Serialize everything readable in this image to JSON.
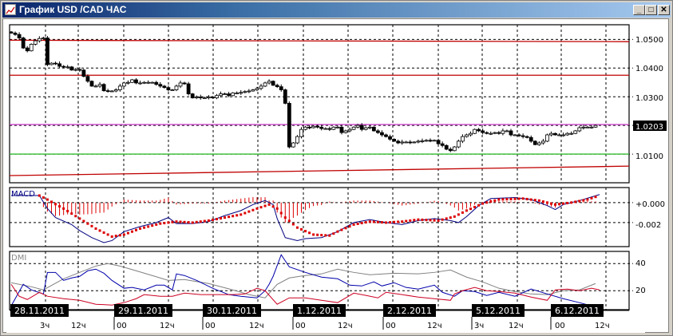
{
  "window": {
    "title": "График USD /CAD  ЧАС",
    "minimize_label": "_",
    "maximize_label": "□",
    "close_label": "✕"
  },
  "colors": {
    "bull": "#ffffff",
    "bear": "#000000",
    "resistance": "#c00000",
    "pivot": "#cc44cc",
    "support": "#33bb33",
    "macd": "#000080",
    "signal": "#dd0000",
    "plus_di": "#0000aa",
    "minus_di": "#cc0022",
    "adx": "#808080"
  },
  "price_axis": {
    "ticks": [
      "1.0500",
      "1.0400",
      "1.0300",
      "1.0100"
    ],
    "current_price": "1.0203"
  },
  "macd_panel": {
    "label": "MACD",
    "ticks": [
      "+0.000",
      "-0.002"
    ]
  },
  "dmi_panel": {
    "label": "DMI",
    "ticks": [
      "40",
      "20"
    ]
  },
  "time_axis": {
    "dates": [
      "28.11.2011",
      "29.11.2011",
      "30.11.2011",
      "1.12.2011",
      "2.12.2011",
      "5.12.2011",
      "6.12.2011"
    ],
    "hours": [
      "3ч",
      "12ч",
      "00",
      "12ч",
      "00",
      "12ч",
      "00",
      "12ч",
      "00",
      "12ч",
      "3ч",
      "12ч",
      "00",
      "12ч"
    ]
  },
  "chart_data": [
    {
      "type": "candlestick",
      "title": "USD/CAD H1",
      "ylim": [
        1.0,
        1.0551
      ],
      "yticks": [
        1.05,
        1.04,
        1.03,
        1.02,
        1.01
      ],
      "levels": [
        {
          "name": "resistance-upper",
          "from": 1.0497,
          "to": 1.0492
        },
        {
          "name": "resistance-mid",
          "from": 1.0375,
          "to": 1.0375
        },
        {
          "name": "pivot",
          "from": 1.0203,
          "to": 1.0203
        },
        {
          "name": "support",
          "from": 1.01,
          "to": 1.01
        },
        {
          "name": "trend-lower",
          "from": 1.0025,
          "to": 1.0058
        }
      ],
      "close": [
        1.0522,
        1.0517,
        1.0505,
        1.047,
        1.046,
        1.0483,
        1.0495,
        1.0503,
        1.0505,
        1.0412,
        1.0417,
        1.0415,
        1.0406,
        1.0404,
        1.0404,
        1.0393,
        1.0395,
        1.0393,
        1.0371,
        1.0354,
        1.0337,
        1.0337,
        1.0343,
        1.0321,
        1.032,
        1.032,
        1.0324,
        1.0337,
        1.0348,
        1.035,
        1.0359,
        1.0348,
        1.0348,
        1.035,
        1.035,
        1.035,
        1.0343,
        1.0337,
        1.0332,
        1.0324,
        1.0324,
        1.0337,
        1.0348,
        1.0345,
        1.031,
        1.0296,
        1.0299,
        1.0296,
        1.0296,
        1.0299,
        1.0296,
        1.0304,
        1.031,
        1.031,
        1.0304,
        1.0313,
        1.0313,
        1.0315,
        1.0318,
        1.032,
        1.0324,
        1.0329,
        1.0337,
        1.0348,
        1.0354,
        1.034,
        1.0335,
        1.0324,
        1.0277,
        1.0125,
        1.0139,
        1.0161,
        1.0186,
        1.0194,
        1.0192,
        1.0197,
        1.0194,
        1.0189,
        1.0189,
        1.0186,
        1.0194,
        1.0194,
        1.0175,
        1.0181,
        1.0186,
        1.0194,
        1.02,
        1.0186,
        1.0192,
        1.0194,
        1.0181,
        1.0175,
        1.0167,
        1.0161,
        1.0152,
        1.0145,
        1.0139,
        1.0142,
        1.0142,
        1.014,
        1.0142,
        1.0145,
        1.0146,
        1.0148,
        1.0147,
        1.0148,
        1.0136,
        1.013,
        1.0117,
        1.0112,
        1.0125,
        1.0145,
        1.0161,
        1.0167,
        1.0172,
        1.0186,
        1.0181,
        1.0175,
        1.0172,
        1.0172,
        1.0175,
        1.0172,
        1.0181,
        1.0181,
        1.0167,
        1.0167,
        1.0164,
        1.0161,
        1.0158,
        1.0145,
        1.0133,
        1.0139,
        1.0145,
        1.0167,
        1.0172,
        1.0167,
        1.0167,
        1.0167,
        1.0172,
        1.0172,
        1.0181,
        1.0192,
        1.0194,
        1.0194,
        1.0194,
        1.02
      ]
    },
    {
      "type": "line",
      "title": "MACD",
      "ylim": [
        -0.0044,
        0.0015
      ],
      "macd": [
        [
          0,
          0.0007
        ],
        [
          7,
          0.0007
        ],
        [
          9,
          -0.0006
        ],
        [
          11,
          -0.0015
        ],
        [
          15,
          -0.0022
        ],
        [
          17,
          -0.0028
        ],
        [
          20,
          -0.0035
        ],
        [
          23,
          -0.004
        ],
        [
          25,
          -0.0038
        ],
        [
          28,
          -0.0029
        ],
        [
          32,
          -0.0024
        ],
        [
          36,
          -0.002
        ],
        [
          39,
          -0.0015
        ],
        [
          41,
          -0.0021
        ],
        [
          45,
          -0.0021
        ],
        [
          49,
          -0.0019
        ],
        [
          53,
          -0.0013
        ],
        [
          57,
          -0.0008
        ],
        [
          60,
          -0.0002
        ],
        [
          63,
          0.0002
        ],
        [
          65,
          -0.0002
        ],
        [
          66,
          -0.0016
        ],
        [
          68,
          -0.0035
        ],
        [
          71,
          -0.0038
        ],
        [
          73,
          -0.0036
        ],
        [
          77,
          -0.0035
        ],
        [
          81,
          -0.0029
        ],
        [
          85,
          -0.002
        ],
        [
          89,
          -0.0017
        ],
        [
          93,
          -0.002
        ],
        [
          97,
          -0.0022
        ],
        [
          101,
          -0.0018
        ],
        [
          105,
          -0.0016
        ],
        [
          109,
          -0.0018
        ],
        [
          111,
          -0.002
        ],
        [
          113,
          -0.0014
        ],
        [
          116,
          -0.0003
        ],
        [
          119,
          0.0004
        ],
        [
          125,
          0.0005
        ],
        [
          129,
          0.0003
        ],
        [
          133,
          -0.0003
        ],
        [
          135,
          -0.0007
        ],
        [
          137,
          -0.0002
        ],
        [
          141,
          0.0002
        ],
        [
          146,
          0.0008
        ]
      ],
      "signal": [
        [
          7,
          0.0007
        ],
        [
          9,
          0.0003
        ],
        [
          13,
          -0.0006
        ],
        [
          17,
          -0.0016
        ],
        [
          21,
          -0.0026
        ],
        [
          25,
          -0.0034
        ],
        [
          28,
          -0.0032
        ],
        [
          32,
          -0.0026
        ],
        [
          37,
          -0.0021
        ],
        [
          41,
          -0.0019
        ],
        [
          45,
          -0.002
        ],
        [
          49,
          -0.0018
        ],
        [
          53,
          -0.0015
        ],
        [
          57,
          -0.0012
        ],
        [
          61,
          -0.0006
        ],
        [
          64,
          -0.0002
        ],
        [
          66,
          -0.0006
        ],
        [
          68,
          -0.0015
        ],
        [
          71,
          -0.0025
        ],
        [
          75,
          -0.0032
        ],
        [
          79,
          -0.0033
        ],
        [
          81,
          -0.0029
        ],
        [
          85,
          -0.0022
        ],
        [
          89,
          -0.0019
        ],
        [
          93,
          -0.002
        ],
        [
          97,
          -0.0019
        ],
        [
          101,
          -0.0017
        ],
        [
          106,
          -0.0018
        ],
        [
          110,
          -0.0014
        ],
        [
          113,
          -0.0008
        ],
        [
          117,
          -0.0001
        ],
        [
          121,
          0.0003
        ],
        [
          127,
          0.0004
        ],
        [
          131,
          0.0002
        ],
        [
          135,
          -0.0002
        ],
        [
          139,
          0.0
        ],
        [
          143,
          0.0003
        ],
        [
          146,
          0.0007
        ]
      ]
    },
    {
      "type": "line",
      "title": "DMI",
      "ylim": [
        6,
        49
      ],
      "plus_di": [
        [
          0,
          8.8
        ],
        [
          3,
          24.7
        ],
        [
          5,
          20.6
        ],
        [
          8,
          17.6
        ],
        [
          9,
          33.5
        ],
        [
          11,
          33.5
        ],
        [
          13,
          27.6
        ],
        [
          15,
          29.4
        ],
        [
          17,
          30.6
        ],
        [
          19,
          34.7
        ],
        [
          21,
          35.9
        ],
        [
          23,
          32.9
        ],
        [
          25,
          27.6
        ],
        [
          28,
          21.8
        ],
        [
          30,
          22.4
        ],
        [
          33,
          20.6
        ],
        [
          36,
          24.1
        ],
        [
          38,
          24.1
        ],
        [
          40,
          20.6
        ],
        [
          41,
          32.4
        ],
        [
          43,
          31.2
        ],
        [
          46,
          27.6
        ],
        [
          50,
          21.8
        ],
        [
          54,
          17.1
        ],
        [
          57,
          15.9
        ],
        [
          61,
          14.7
        ],
        [
          63,
          20
        ],
        [
          64,
          24.7
        ],
        [
          65,
          30.6
        ],
        [
          67,
          46.5
        ],
        [
          69,
          37.6
        ],
        [
          73,
          33.5
        ],
        [
          77,
          30
        ],
        [
          81,
          28.8
        ],
        [
          84,
          24.1
        ],
        [
          87,
          23.5
        ],
        [
          90,
          26.5
        ],
        [
          92,
          23.5
        ],
        [
          95,
          25.9
        ],
        [
          98,
          22.4
        ],
        [
          101,
          21.2
        ],
        [
          105,
          24.1
        ],
        [
          107,
          18.8
        ],
        [
          110,
          15.9
        ],
        [
          112,
          20
        ],
        [
          115,
          19.4
        ],
        [
          118,
          16.5
        ],
        [
          121,
          18.8
        ],
        [
          125,
          15.9
        ],
        [
          129,
          21.2
        ],
        [
          133,
          17.6
        ],
        [
          137,
          14.1
        ],
        [
          141,
          11.2
        ],
        [
          144,
          8.8
        ]
      ],
      "minus_di": [
        [
          0,
          24.7
        ],
        [
          2,
          15.9
        ],
        [
          4,
          13.5
        ],
        [
          7,
          18.8
        ],
        [
          9,
          15.9
        ],
        [
          13,
          14.1
        ],
        [
          17,
          12.9
        ],
        [
          21,
          10
        ],
        [
          25,
          9.4
        ],
        [
          28,
          11.2
        ],
        [
          31,
          14.1
        ],
        [
          33,
          17.1
        ],
        [
          37,
          15.9
        ],
        [
          40,
          15.9
        ],
        [
          43,
          18.2
        ],
        [
          47,
          17.1
        ],
        [
          51,
          17.1
        ],
        [
          55,
          17.1
        ],
        [
          58,
          17.6
        ],
        [
          61,
          21.8
        ],
        [
          63,
          20
        ],
        [
          66,
          10
        ],
        [
          69,
          14.7
        ],
        [
          73,
          14.7
        ],
        [
          77,
          12.9
        ],
        [
          81,
          11.2
        ],
        [
          85,
          18.2
        ],
        [
          88,
          16.5
        ],
        [
          91,
          14.7
        ],
        [
          93,
          18.8
        ],
        [
          97,
          17.1
        ],
        [
          101,
          15.3
        ],
        [
          105,
          14.1
        ],
        [
          109,
          12.9
        ],
        [
          110,
          17.6
        ],
        [
          112,
          20
        ],
        [
          115,
          22.4
        ],
        [
          118,
          20
        ],
        [
          121,
          19.4
        ],
        [
          125,
          18.2
        ],
        [
          129,
          15.3
        ],
        [
          133,
          12.9
        ],
        [
          135,
          20.6
        ],
        [
          138,
          21.2
        ],
        [
          141,
          20
        ],
        [
          144,
          21.8
        ],
        [
          146,
          20.6
        ]
      ],
      "adx": [
        [
          0,
          25.9
        ],
        [
          5,
          22.9
        ],
        [
          8,
          20.6
        ],
        [
          13,
          28.8
        ],
        [
          17,
          33.5
        ],
        [
          21,
          38.2
        ],
        [
          24,
          40
        ],
        [
          27,
          38.2
        ],
        [
          31,
          34.7
        ],
        [
          35,
          31.2
        ],
        [
          39,
          27.6
        ],
        [
          43,
          28.2
        ],
        [
          49,
          25.3
        ],
        [
          55,
          20.6
        ],
        [
          59,
          17.1
        ],
        [
          63,
          14.7
        ],
        [
          66,
          24.7
        ],
        [
          69,
          29.4
        ],
        [
          73,
          31.2
        ],
        [
          77,
          32.4
        ],
        [
          81,
          35.9
        ],
        [
          85,
          33.5
        ],
        [
          89,
          31.8
        ],
        [
          95,
          32.9
        ],
        [
          101,
          32.4
        ],
        [
          105,
          33.5
        ],
        [
          109,
          35.3
        ],
        [
          113,
          30
        ],
        [
          117,
          26.5
        ],
        [
          121,
          21.8
        ],
        [
          125,
          19.4
        ],
        [
          129,
          17.6
        ],
        [
          133,
          17.1
        ],
        [
          137,
          20
        ],
        [
          141,
          20.6
        ],
        [
          145,
          25.3
        ]
      ]
    }
  ]
}
